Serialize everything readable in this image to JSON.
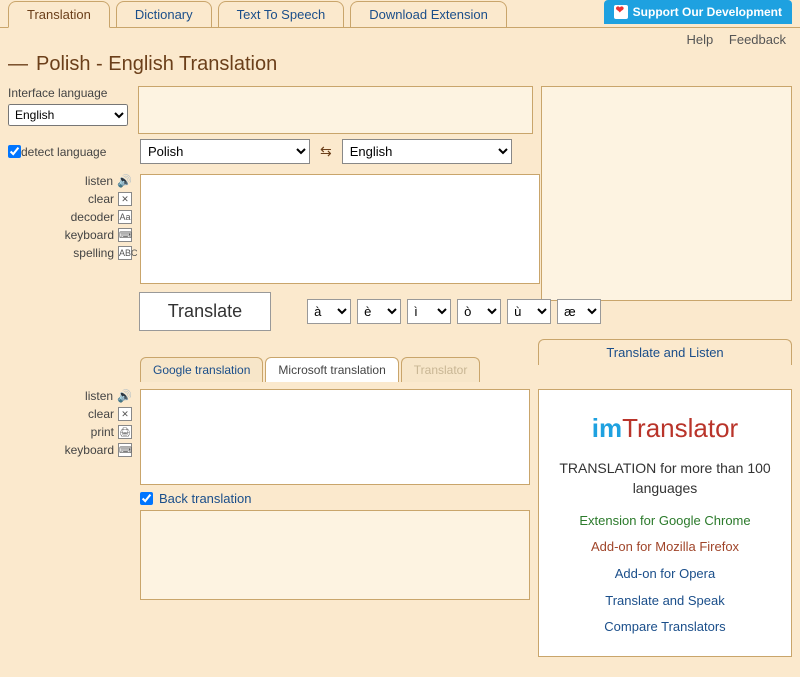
{
  "tabs": {
    "translation": "Translation",
    "dictionary": "Dictionary",
    "tts": "Text To Speech",
    "download": "Download Extension"
  },
  "support_btn": "Support Our Development",
  "help": "Help",
  "feedback": "Feedback",
  "title": "Polish - English Translation",
  "interface_lang_label": "Interface language",
  "interface_lang_value": "English",
  "detect_label": "detect language",
  "src_lang": "Polish",
  "tgt_lang": "English",
  "tools_src": {
    "listen": "listen",
    "clear": "clear",
    "decoder": "decoder",
    "keyboard": "keyboard",
    "spelling": "spelling"
  },
  "translate_btn": "Translate",
  "accents": [
    "à",
    "è",
    "ì",
    "ò",
    "ù",
    "æ"
  ],
  "sub_tabs": {
    "google": "Google translation",
    "microsoft": "Microsoft translation",
    "translator": "Translator"
  },
  "tools_res": {
    "listen": "listen",
    "clear": "clear",
    "print": "print",
    "keyboard": "keyboard"
  },
  "back_translation_label": "Back translation",
  "right_tab": "Translate and Listen",
  "promo": {
    "logo_im": "im",
    "logo_tr": "Translator",
    "sub": "TRANSLATION for more than 100 languages",
    "chrome": "Extension for Google Chrome",
    "firefox": "Add-on for Mozilla Firefox",
    "opera": "Add-on for Opera",
    "speak": "Translate and Speak",
    "compare": "Compare Translators"
  }
}
